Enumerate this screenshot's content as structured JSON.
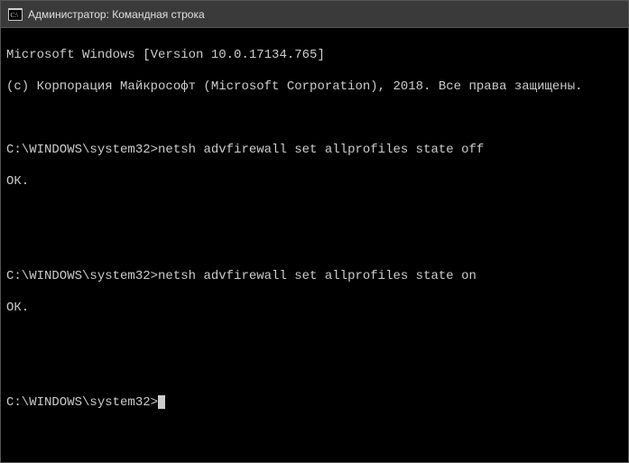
{
  "window": {
    "title": "Администратор: Командная строка"
  },
  "terminal": {
    "header1": "Microsoft Windows [Version 10.0.17134.765]",
    "header2": "(c) Корпорация Майкрософт (Microsoft Corporation), 2018. Все права защищены.",
    "blank": "",
    "sessions": [
      {
        "prompt": "C:\\WINDOWS\\system32>",
        "command": "netsh advfirewall set allprofiles state off",
        "output": "ОК."
      },
      {
        "prompt": "C:\\WINDOWS\\system32>",
        "command": "netsh advfirewall set allprofiles state on",
        "output": "ОК."
      }
    ],
    "current_prompt": "C:\\WINDOWS\\system32>"
  }
}
